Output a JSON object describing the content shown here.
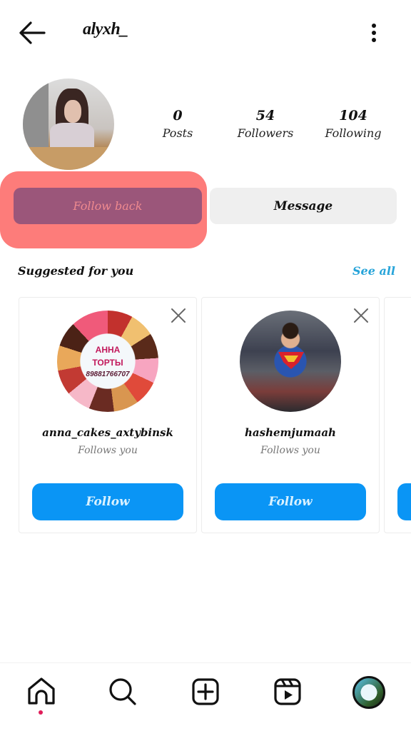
{
  "header": {
    "username": "alyxh_",
    "back_icon": "arrow-left-icon",
    "menu_icon": "more-vertical-icon"
  },
  "profile": {
    "stats": [
      {
        "value": "0",
        "label": "Posts"
      },
      {
        "value": "54",
        "label": "Followers"
      },
      {
        "value": "104",
        "label": "Following"
      }
    ],
    "follow_back_label": "Follow back",
    "message_label": "Message",
    "highlight_color": "#fd7c7a"
  },
  "suggested": {
    "title": "Suggested for you",
    "see_all_label": "See all",
    "cards": [
      {
        "username": "anna_cakes_axtybinsk",
        "subtitle": "Follows you",
        "button_label": "Follow",
        "avatar_text": [
          "АННА",
          "ТОРТЫ",
          "89881766707"
        ]
      },
      {
        "username": "hashemjumaah",
        "subtitle": "Follows you",
        "button_label": "Follow"
      }
    ],
    "partial_card_button_label": ""
  },
  "bottom_nav": {
    "items": [
      "home-icon",
      "search-icon",
      "new-post-icon",
      "reels-icon",
      "profile-icon"
    ],
    "active": "home",
    "notification_dot_color": "#e01e5a"
  },
  "colors": {
    "follow_button": "#0a95f5",
    "see_all_link": "#27a4d9",
    "follow_back_button": "#9b567a"
  }
}
